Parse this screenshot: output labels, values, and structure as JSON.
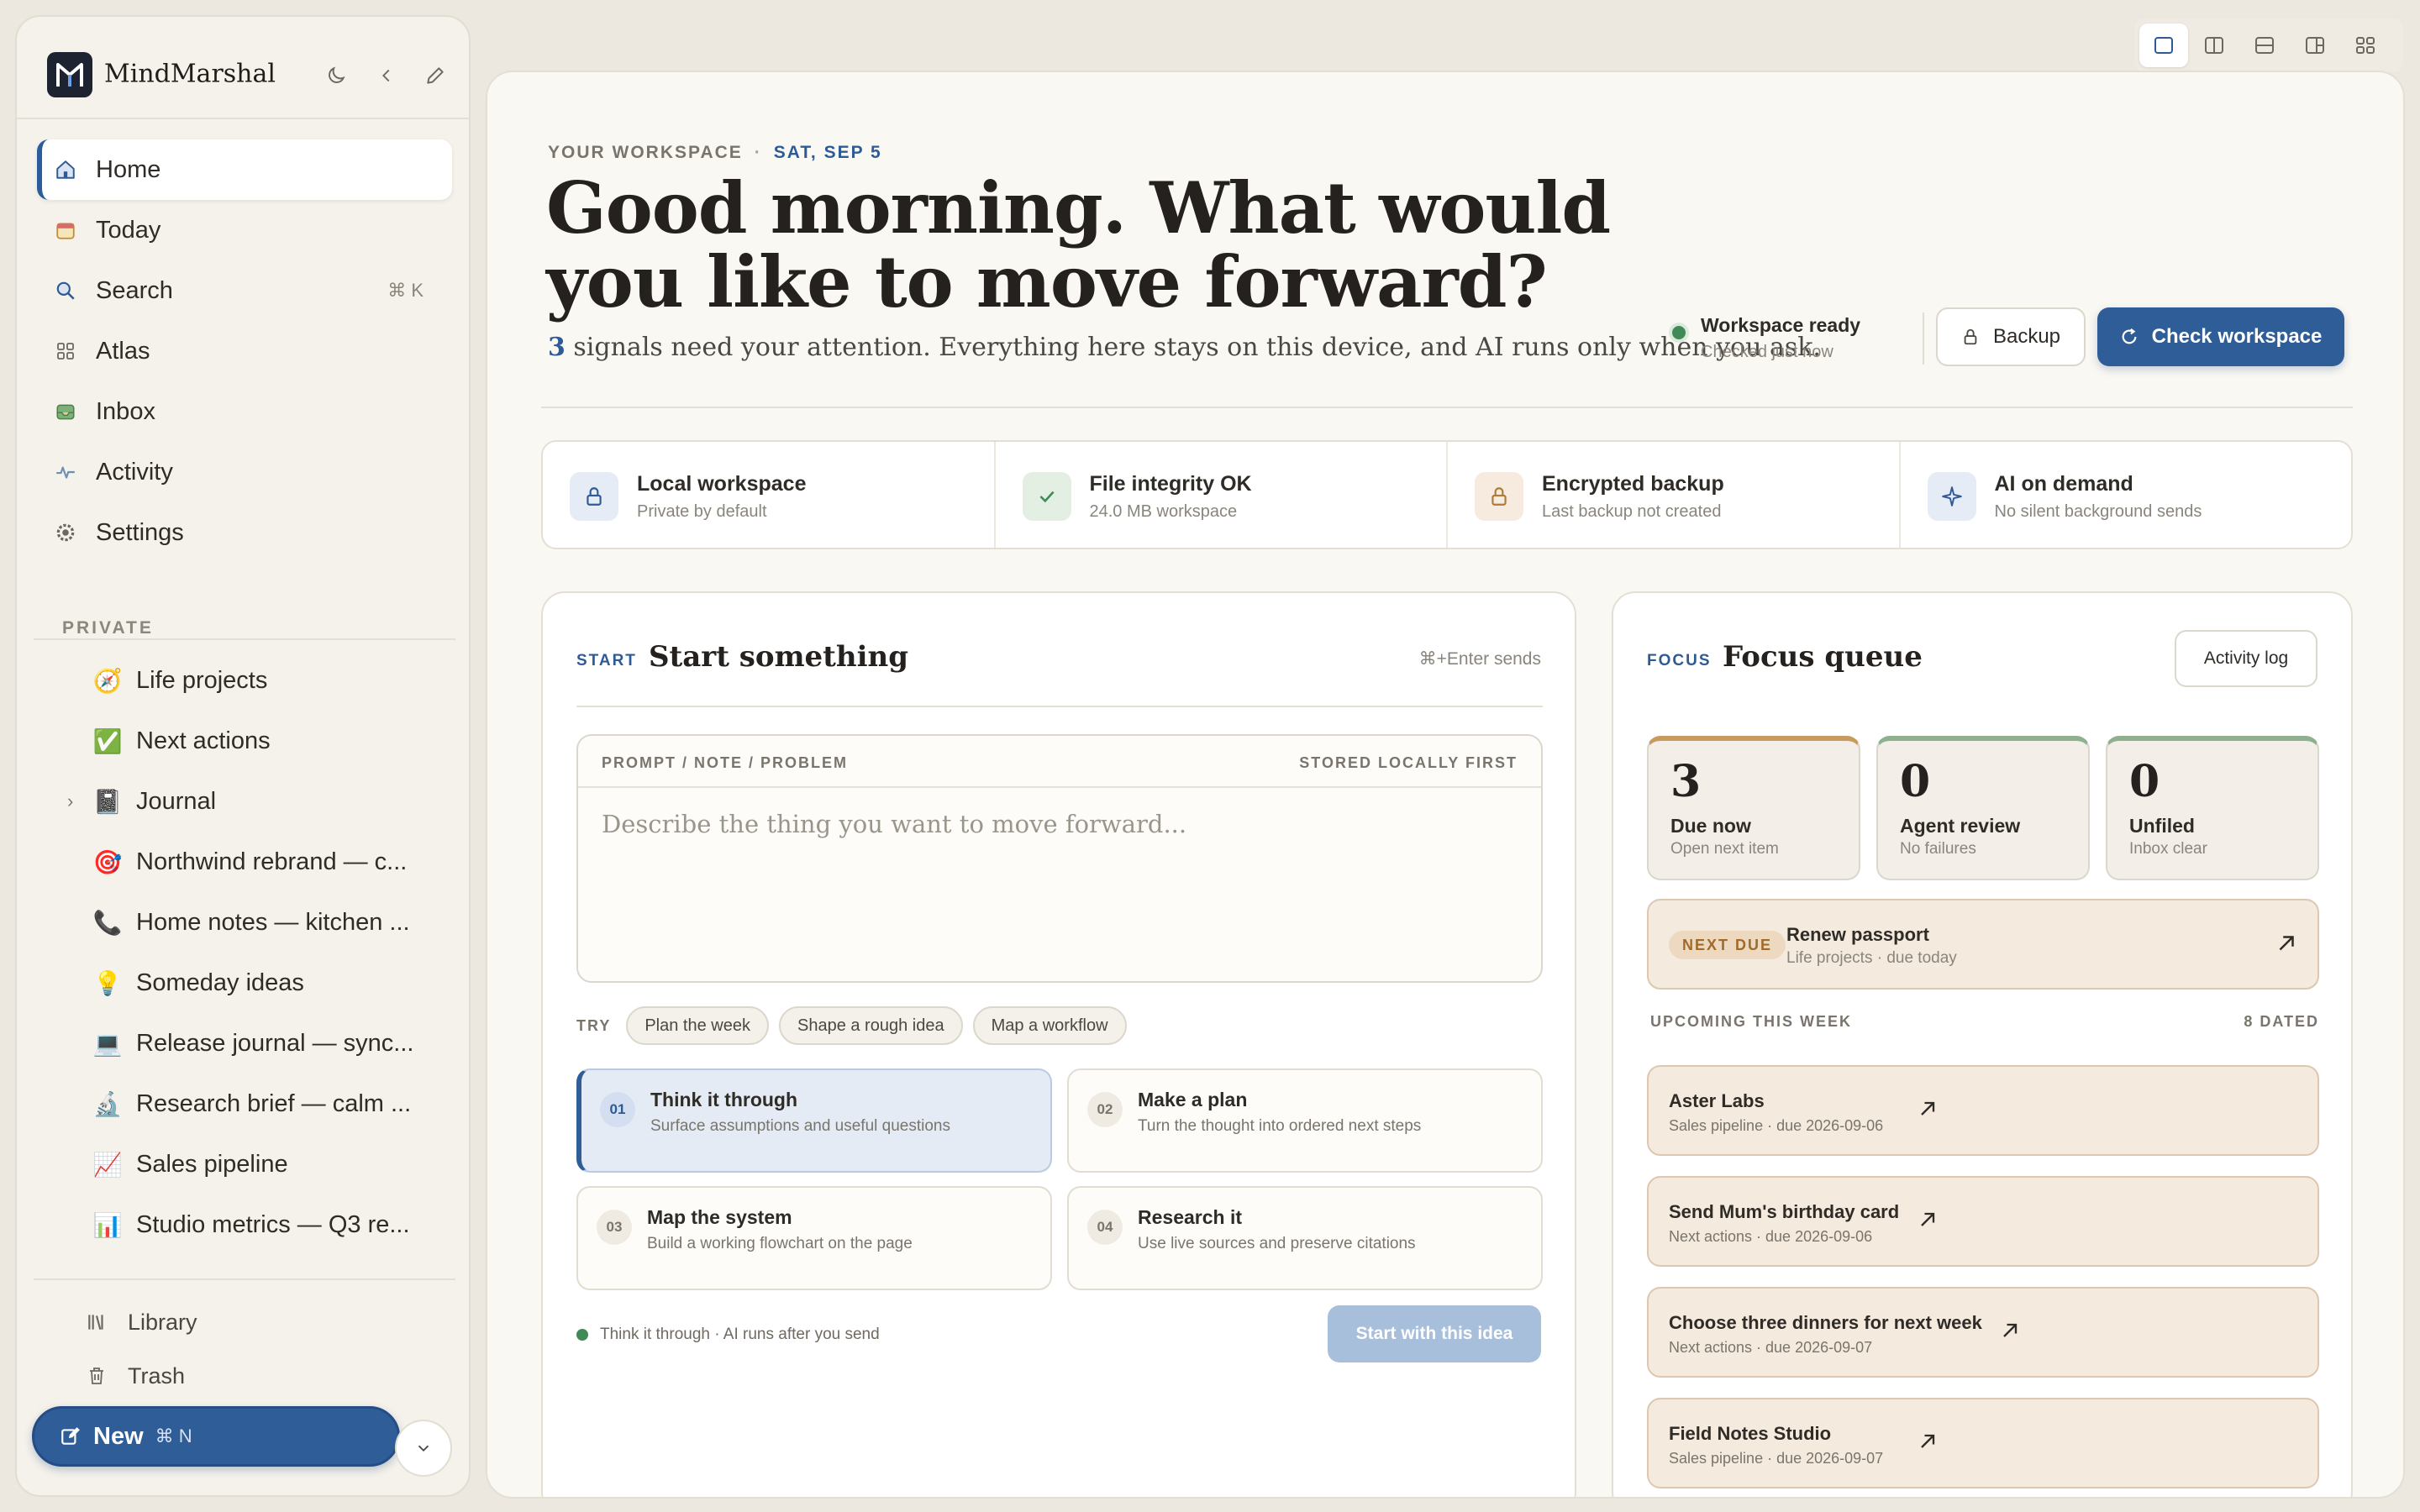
{
  "app": {
    "name": "MindMarshal"
  },
  "sidebar": {
    "nav": [
      {
        "label": "Home",
        "icon": "home-icon"
      },
      {
        "label": "Today",
        "icon": "calendar-icon"
      },
      {
        "label": "Search",
        "icon": "search-icon",
        "shortcut": "⌘ K"
      },
      {
        "label": "Atlas",
        "icon": "grid-icon"
      },
      {
        "label": "Inbox",
        "icon": "inbox-icon"
      },
      {
        "label": "Activity",
        "icon": "activity-icon"
      },
      {
        "label": "Settings",
        "icon": "gear-icon"
      }
    ],
    "section_label": "PRIVATE",
    "pages": [
      {
        "emoji": "🧭",
        "label": "Life projects"
      },
      {
        "emoji": "✅",
        "label": "Next actions"
      },
      {
        "emoji": "📓",
        "label": "Journal",
        "expandable": true
      },
      {
        "emoji": "🎯",
        "label": "Northwind rebrand — c..."
      },
      {
        "emoji": "📞",
        "label": "Home notes — kitchen ..."
      },
      {
        "emoji": "💡",
        "label": "Someday ideas"
      },
      {
        "emoji": "💻",
        "label": "Release journal — sync..."
      },
      {
        "emoji": "🔬",
        "label": "Research brief — calm ..."
      },
      {
        "emoji": "📈",
        "label": "Sales pipeline"
      },
      {
        "emoji": "📊",
        "label": "Studio metrics — Q3 re..."
      }
    ],
    "footer": [
      {
        "label": "Library",
        "icon": "library-icon"
      },
      {
        "label": "Trash",
        "icon": "trash-icon"
      }
    ],
    "new_button": {
      "label": "New",
      "shortcut": "⌘ N"
    }
  },
  "header": {
    "eyebrow": "YOUR WORKSPACE",
    "date": "SAT, SEP 5",
    "headline": "Good morning. What would you like to move forward?",
    "signal_count": "3",
    "subline": " signals need your attention. Everything here stays on this device, and AI runs only when you ask.",
    "status_title": "Workspace ready",
    "status_sub": "Checked just now",
    "backup_label": "Backup",
    "check_label": "Check workspace"
  },
  "stats": [
    {
      "title": "Local workspace",
      "sub": "Private by default",
      "icon": "lock-icon",
      "color": "#2e5b97"
    },
    {
      "title": "File integrity OK",
      "sub": "24.0 MB workspace",
      "icon": "check-icon",
      "color": "#3f8a55"
    },
    {
      "title": "Encrypted backup",
      "sub": "Last backup not created",
      "icon": "lock-icon",
      "color": "#b07a3a"
    },
    {
      "title": "AI on demand",
      "sub": "No silent background sends",
      "icon": "sparkle-icon",
      "color": "#2e5b97"
    }
  ],
  "start": {
    "tag": "START",
    "title": "Start something",
    "hint": "⌘+Enter sends",
    "prompt_label": "PROMPT / NOTE / PROBLEM",
    "prompt_note": "STORED LOCALLY FIRST",
    "prompt_placeholder": "Describe the thing you want to move forward...",
    "try_label": "TRY",
    "chips": [
      "Plan the week",
      "Shape a rough idea",
      "Map a workflow"
    ],
    "modes": [
      {
        "num": "01",
        "title": "Think it through",
        "desc": "Surface assumptions and useful questions"
      },
      {
        "num": "02",
        "title": "Make a plan",
        "desc": "Turn the thought into ordered next steps"
      },
      {
        "num": "03",
        "title": "Map the system",
        "desc": "Build a working flowchart on the page"
      },
      {
        "num": "04",
        "title": "Research it",
        "desc": "Use live sources and preserve citations"
      }
    ],
    "footer_status": "Think it through · AI runs after you send",
    "start_button": "Start with this idea"
  },
  "focus": {
    "tag": "FOCUS",
    "title": "Focus queue",
    "activity_button": "Activity log",
    "metrics": [
      {
        "value": "3",
        "title": "Due now",
        "sub": "Open next item",
        "accent": "#c99a5e"
      },
      {
        "value": "0",
        "title": "Agent review",
        "sub": "No failures",
        "accent": "#8fb08f"
      },
      {
        "value": "0",
        "title": "Unfiled",
        "sub": "Inbox clear",
        "accent": "#8fb08f"
      }
    ],
    "next_due": {
      "badge": "NEXT DUE",
      "title": "Renew passport",
      "sub": "Life projects · due today"
    },
    "upcoming_label": "UPCOMING THIS WEEK",
    "upcoming_count": "8 DATED",
    "upcoming": [
      {
        "title": "Aster Labs",
        "sub": "Sales pipeline · due 2026-09-06"
      },
      {
        "title": "Send Mum's birthday card",
        "sub": "Next actions · due 2026-09-06"
      },
      {
        "title": "Choose three dinners for next week",
        "sub": "Next actions · due 2026-09-07"
      },
      {
        "title": "Field Notes Studio",
        "sub": "Sales pipeline · due 2026-09-07"
      }
    ]
  }
}
